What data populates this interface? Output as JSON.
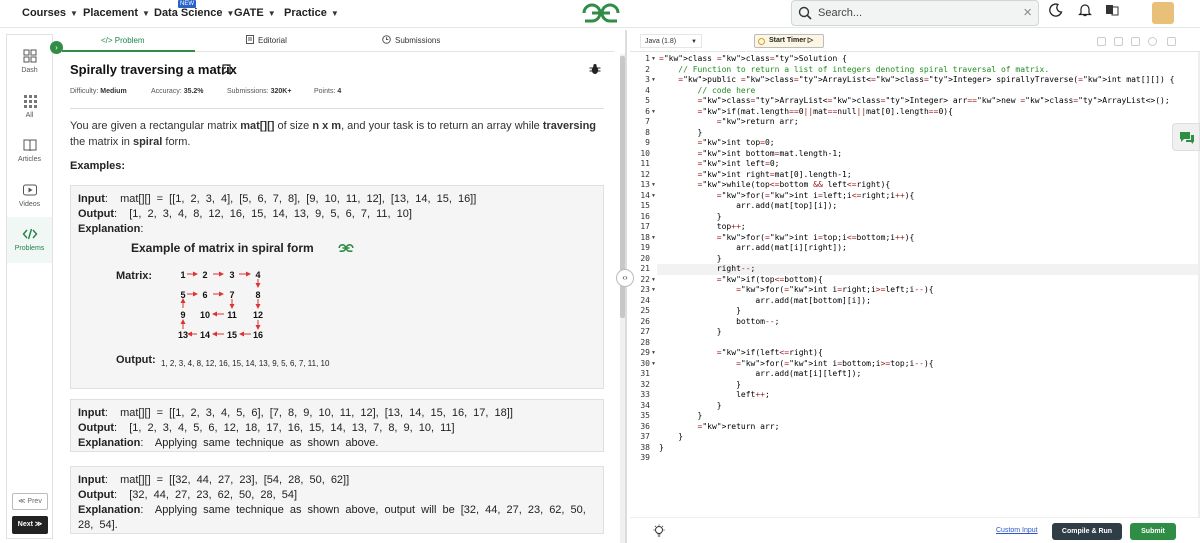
{
  "nav": {
    "items": [
      {
        "label": "Courses"
      },
      {
        "label": "Placement"
      },
      {
        "label": "Data Science"
      },
      {
        "label": "GATE"
      },
      {
        "label": "Practice"
      }
    ],
    "new_badge": "NEW",
    "search_placeholder": "Search..."
  },
  "sidebar": {
    "items": [
      {
        "label": "Dash"
      },
      {
        "label": "All"
      },
      {
        "label": "Articles"
      },
      {
        "label": "Videos"
      },
      {
        "label": "Problems"
      }
    ],
    "prev": "≪ Prev",
    "next": "Next ≫"
  },
  "tabs": {
    "problem": "</> Problem",
    "editorial": "Editorial",
    "submissions": "Submissions"
  },
  "problem": {
    "title": "Spirally traversing a matrix",
    "difficulty_label": "Difficulty:",
    "difficulty": "Medium",
    "accuracy_label": "Accuracy:",
    "accuracy": "35.2%",
    "submissions_label": "Submissions:",
    "submissions": "320K+",
    "points_label": "Points:",
    "points": "4",
    "desc_1": "You are given a rectangular matrix ",
    "desc_mat": "mat[][]",
    "desc_2": " of size ",
    "desc_nxm": "n x m",
    "desc_3": ", and your task is to return an array while ",
    "desc_trav": "traversing",
    "desc_4": " the matrix in ",
    "desc_spiral": "spiral",
    "desc_5": " form.",
    "examples_title": "Examples:",
    "examples": [
      {
        "input": "mat[][] = [[1, 2, 3, 4], [5, 6, 7, 8], [9, 10, 11, 12], [13, 14, 15, 16]]",
        "output": "[1, 2, 3, 4, 8, 12, 16, 15, 14, 13, 9, 5, 6, 7, 11, 10]",
        "explanation": ""
      },
      {
        "input": "mat[][] = [[1, 2, 3, 4, 5, 6], [7, 8, 9, 10, 11, 12], [13, 14, 15, 16, 17, 18]]",
        "output": "[1, 2, 3, 4, 5, 6, 12, 18, 17, 16, 15, 14, 13, 7, 8, 9, 10, 11]",
        "explanation": "Applying same technique as shown above."
      },
      {
        "input": "mat[][] = [[32, 44, 27, 23], [54, 28, 50, 62]]",
        "output": "[32, 44, 27, 23, 62, 50, 28, 54]",
        "explanation": "Applying same technique as shown above, output will be [32, 44, 27, 23, 62, 50, 28, 54]."
      }
    ],
    "labels": {
      "input": "Input",
      "output": "Output",
      "explanation": "Explanation"
    },
    "figure": {
      "title": "Example of matrix in spiral form",
      "matrix_label": "Matrix:",
      "output_label": "Output:",
      "output": "1, 2, 3, 4, 8, 12, 16, 15, 14, 13, 9, 5, 6, 7, 11, 10",
      "grid": [
        [
          "1",
          "2",
          "3",
          "4"
        ],
        [
          "5",
          "6",
          "7",
          "8"
        ],
        [
          "9",
          "10",
          "11",
          "12"
        ],
        [
          "13",
          "14",
          "15",
          "16"
        ]
      ]
    }
  },
  "editor": {
    "language": "Java (1.8)",
    "timer": "Start Timer",
    "lines": [
      "class Solution {",
      "    // Function to return a list of integers denoting spiral traversal of matrix.",
      "    public ArrayList<Integer> spirallyTraverse(int mat[][]) {",
      "        // code here",
      "        ArrayList<Integer> arr=new ArrayList<>();",
      "        if(mat.length==0||mat==null||mat[0].length==0){",
      "            return arr;",
      "        }",
      "        int top=0;",
      "        int bottom=mat.length-1;",
      "        int left=0;",
      "        int right=mat[0].length-1;",
      "        while(top<=bottom && left<=right){",
      "            for(int i=left;i<=right;i++){",
      "                arr.add(mat[top][i]);",
      "            }",
      "            top++;",
      "            for(int i=top;i<=bottom;i++){",
      "                arr.add(mat[i][right]);",
      "            }",
      "            right--;",
      "            if(top<=bottom){",
      "                for(int i=right;i>=left;i--){",
      "                    arr.add(mat[bottom][i]);",
      "                }",
      "                bottom--;",
      "            }",
      "",
      "            if(left<=right){",
      "                for(int i=bottom;i>=top;i--){",
      "                    arr.add(mat[i][left]);",
      "                }",
      "                left++;",
      "            }",
      "        }",
      "        return arr;",
      "    }",
      "}",
      ""
    ],
    "folds": [
      1,
      3,
      6,
      13,
      14,
      18,
      22,
      23,
      29,
      30
    ],
    "highlight_line": 21,
    "custom_input": "Custom Input",
    "compile": "Compile & Run",
    "submit": "Submit"
  },
  "colors": {
    "brand": "#2f8d46",
    "dark": "#2f3d46",
    "link": "#2c56c9"
  }
}
